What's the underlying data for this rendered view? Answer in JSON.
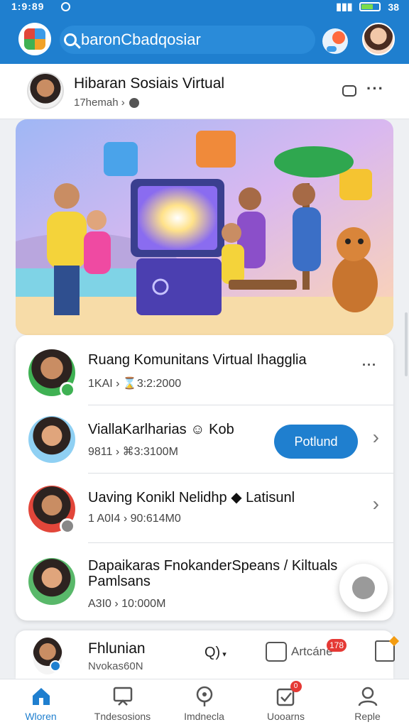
{
  "status_bar": {
    "time": "1:9:89",
    "right_text": "38"
  },
  "search": {
    "placeholder": "baronCbadqosiar"
  },
  "group": {
    "title": "Hibaran Sosiais Virtual",
    "subtitle": "17hemah ›"
  },
  "rows": [
    {
      "title": "Ruang Komunitans Virtual Ihagglia",
      "meta": "1KAI › ⌛3:2:2000",
      "accent": "#3fb153"
    },
    {
      "title": "ViallaKarlharias ☺ Kob",
      "meta": "9811 › ⌘3:3100M",
      "button": "Potlund",
      "accent": "#3c9be8"
    },
    {
      "title": "Uaving Konikl Nelidhp ◆ Latisunl",
      "meta": "1 A0I4 › 90:614M0",
      "accent": "#e2463a"
    },
    {
      "title": "Dapaikaras FnokanderSpeans / Kiltuals",
      "title_line2": "Pamlsans",
      "meta": "A3I0 › 10:000M",
      "accent": "#3fb153"
    }
  ],
  "bottom_card": {
    "title": "Fhlunian",
    "subtitle": "Nvokas60N",
    "q_label": "Q)",
    "action_label": "Artcáne",
    "action_count": "178"
  },
  "nav": [
    {
      "label": "Wloren",
      "icon": "home-icon",
      "active": true
    },
    {
      "label": "Tndesosions",
      "icon": "board-icon"
    },
    {
      "label": "Imdnecla",
      "icon": "location-icon"
    },
    {
      "label": "Uooarns",
      "icon": "check-icon",
      "badge": "0"
    },
    {
      "label": "Reple",
      "icon": "profile-icon"
    }
  ],
  "colors": {
    "primary": "#1f7fcf",
    "badge": "#e53935"
  }
}
